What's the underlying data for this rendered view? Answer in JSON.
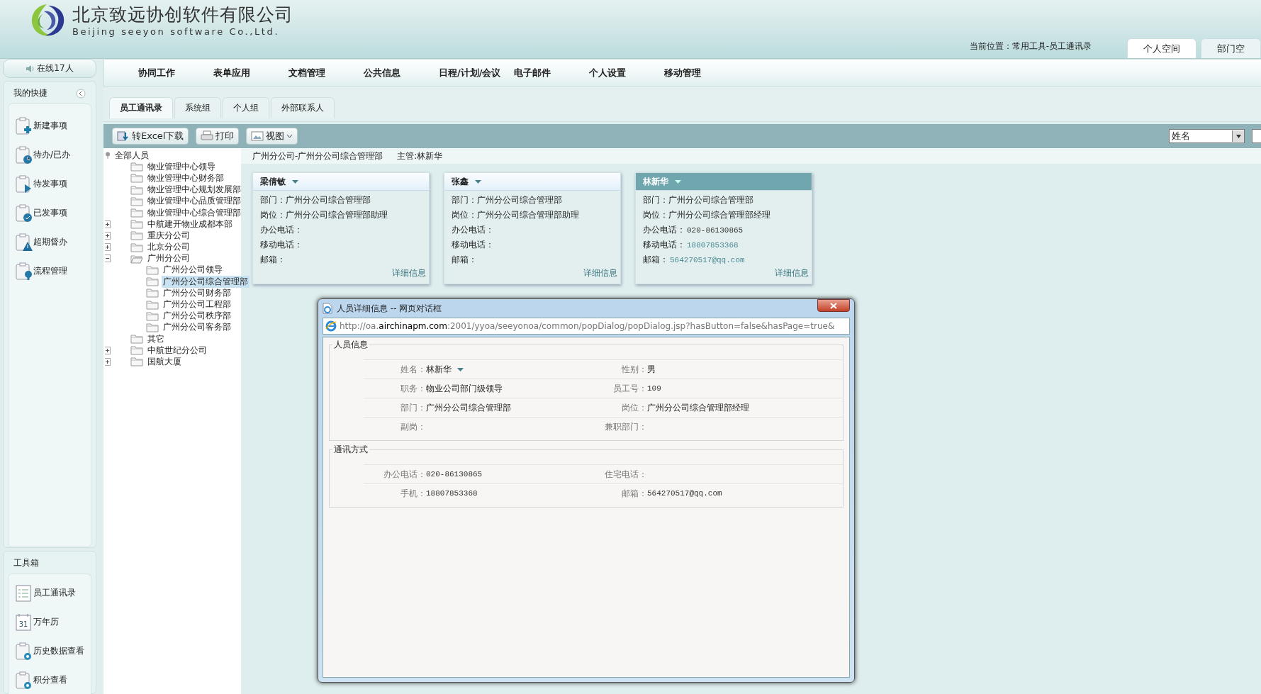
{
  "header": {
    "company_name": "北京致远协创软件有限公司",
    "company_name_en": "Beijing seeyon software Co.,Ltd.",
    "location": "当前位置：常用工具-员工通讯录",
    "space_tabs": [
      {
        "label": "个人空间",
        "selected": true
      },
      {
        "label": "部门空",
        "selected": false
      }
    ]
  },
  "sidebar": {
    "online": "在线17人",
    "shortcuts_title": "我的快捷",
    "shortcuts": [
      {
        "label": "新建事项",
        "kind": "plus"
      },
      {
        "label": "待办/已办",
        "kind": "clock"
      },
      {
        "label": "待发事项",
        "kind": "arrow"
      },
      {
        "label": "已发事项",
        "kind": "check"
      },
      {
        "label": "超期督办",
        "kind": "warning"
      },
      {
        "label": "流程管理",
        "kind": "flow"
      }
    ],
    "toolbox_title": "工具箱",
    "tools": [
      {
        "label": "员工通讯录",
        "kind": "list"
      },
      {
        "label": "万年历",
        "kind": "calendar",
        "badge": "31"
      },
      {
        "label": "历史数据查看",
        "kind": "history"
      },
      {
        "label": "积分查看",
        "kind": "history"
      }
    ]
  },
  "menu": [
    "协同工作",
    "表单应用",
    "文档管理",
    "公共信息",
    "日程/计划/会议",
    "电子邮件",
    "个人设置",
    "移动管理"
  ],
  "tabs": [
    {
      "label": "员工通讯录",
      "selected": true
    },
    {
      "label": "系统组",
      "selected": false
    },
    {
      "label": "个人组",
      "selected": false
    },
    {
      "label": "外部联系人",
      "selected": false
    }
  ],
  "toolbar": {
    "buttons": [
      {
        "label": "转Excel下载",
        "kind": "excel"
      },
      {
        "label": "打印",
        "kind": "print"
      },
      {
        "label": "视图",
        "kind": "view"
      }
    ],
    "search_select": {
      "value": "姓名"
    }
  },
  "tree": {
    "label": "全部人员",
    "expanded": true,
    "selected": false,
    "children": [
      {
        "label": "物业管理中心领导",
        "expandable": false,
        "expanded": false,
        "selected": false
      },
      {
        "label": "物业管理中心财务部",
        "expandable": false,
        "expanded": false,
        "selected": false
      },
      {
        "label": "物业管理中心规划发展部",
        "expandable": false,
        "expanded": false,
        "selected": false
      },
      {
        "label": "物业管理中心品质管理部",
        "expandable": false,
        "expanded": false,
        "selected": false
      },
      {
        "label": "物业管理中心综合管理部",
        "expandable": false,
        "expanded": false,
        "selected": false
      },
      {
        "label": "中航建开物业成都本部",
        "expandable": true,
        "expanded": false,
        "selected": false
      },
      {
        "label": "重庆分公司",
        "expandable": true,
        "expanded": false,
        "selected": false
      },
      {
        "label": "北京分公司",
        "expandable": true,
        "expanded": false,
        "selected": false
      },
      {
        "label": "广州分公司",
        "expandable": true,
        "expanded": true,
        "selected": false,
        "children": [
          {
            "label": "广州分公司领导",
            "expandable": false,
            "expanded": false,
            "selected": false
          },
          {
            "label": "广州分公司综合管理部",
            "expandable": false,
            "expanded": false,
            "selected": true
          },
          {
            "label": "广州分公司财务部",
            "expandable": false,
            "expanded": false,
            "selected": false
          },
          {
            "label": "广州分公司工程部",
            "expandable": false,
            "expanded": false,
            "selected": false
          },
          {
            "label": "广州分公司秩序部",
            "expandable": false,
            "expanded": false,
            "selected": false
          },
          {
            "label": "广州分公司客务部",
            "expandable": false,
            "expanded": false,
            "selected": false
          }
        ]
      },
      {
        "label": "其它",
        "expandable": false,
        "expanded": false,
        "selected": false
      },
      {
        "label": "中航世纪分公司",
        "expandable": true,
        "expanded": false,
        "selected": false
      },
      {
        "label": "国航大厦",
        "expandable": true,
        "expanded": false,
        "selected": false
      }
    ]
  },
  "breadcrumb": {
    "path": "广州分公司-广州分公司综合管理部",
    "manager": "主管:林新华"
  },
  "cards": [
    {
      "name": "梁倩敏",
      "selected": false,
      "link": "详细信息",
      "fields": [
        {
          "label": "部门：",
          "value": "广州分公司综合管理部",
          "kind": "text"
        },
        {
          "label": "岗位：",
          "value": "广州分公司综合管理部助理",
          "kind": "text"
        },
        {
          "label": "办公电话："
        },
        {
          "label": "移动电话："
        },
        {
          "label": "邮箱："
        }
      ]
    },
    {
      "name": "张鑫",
      "selected": false,
      "link": "详细信息",
      "fields": [
        {
          "label": "部门：",
          "value": "广州分公司综合管理部",
          "kind": "text"
        },
        {
          "label": "岗位：",
          "value": "广州分公司综合管理部助理",
          "kind": "text"
        },
        {
          "label": "办公电话："
        },
        {
          "label": "移动电话："
        },
        {
          "label": "邮箱："
        }
      ]
    },
    {
      "name": "林新华",
      "selected": true,
      "link": "详细信息",
      "fields": [
        {
          "label": "部门：",
          "value": "广州分公司综合管理部",
          "kind": "text"
        },
        {
          "label": "岗位：",
          "value": "广州分公司综合管理部经理",
          "kind": "text"
        },
        {
          "label": "办公电话：",
          "value": "020-86130865",
          "kind": "mono"
        },
        {
          "label": "移动电话：",
          "value": "18807853368",
          "kind": "mono_link"
        },
        {
          "label": "邮箱：",
          "value": "564270517@qq.com",
          "kind": "mono_link"
        }
      ]
    }
  ],
  "dialog": {
    "title": "人员详细信息 -- 网页对话框",
    "url": "http://oa.**airchinapm.com**:2001/yyoa/seeyonoa/common/popDialog/popDialog.jsp?hasButton=false&hasPage=true&",
    "sections": [
      {
        "title": "人员信息",
        "rows": [
          [
            {
              "label": "姓名：",
              "value": "林新华",
              "kind": "dropdown"
            },
            {
              "label": "性别：",
              "value": "男",
              "kind": "text"
            }
          ],
          [
            {
              "label": "职务：",
              "value": "物业公司部门级领导",
              "kind": "text"
            },
            {
              "label": "员工号：",
              "value": "109",
              "kind": "mono"
            }
          ],
          [
            {
              "label": "部门：",
              "value": "广州分公司综合管理部",
              "kind": "text"
            },
            {
              "label": "岗位：",
              "value": "广州分公司综合管理部经理",
              "kind": "text"
            }
          ],
          [
            {
              "label": "副岗：",
              "kind": "text"
            },
            {
              "label": "兼职部门：",
              "kind": "text"
            }
          ]
        ]
      },
      {
        "title": "通讯方式",
        "rows": [
          [
            {
              "label": "办公电话：",
              "value": "020-86130865",
              "kind": "mono"
            },
            {
              "label": "住宅电话：",
              "kind": "text"
            }
          ],
          [
            {
              "label": "手机：",
              "value": "18807853368",
              "kind": "mono"
            },
            {
              "label": "邮箱：",
              "value": "564270517@qq.com",
              "kind": "mono"
            }
          ]
        ]
      }
    ]
  }
}
